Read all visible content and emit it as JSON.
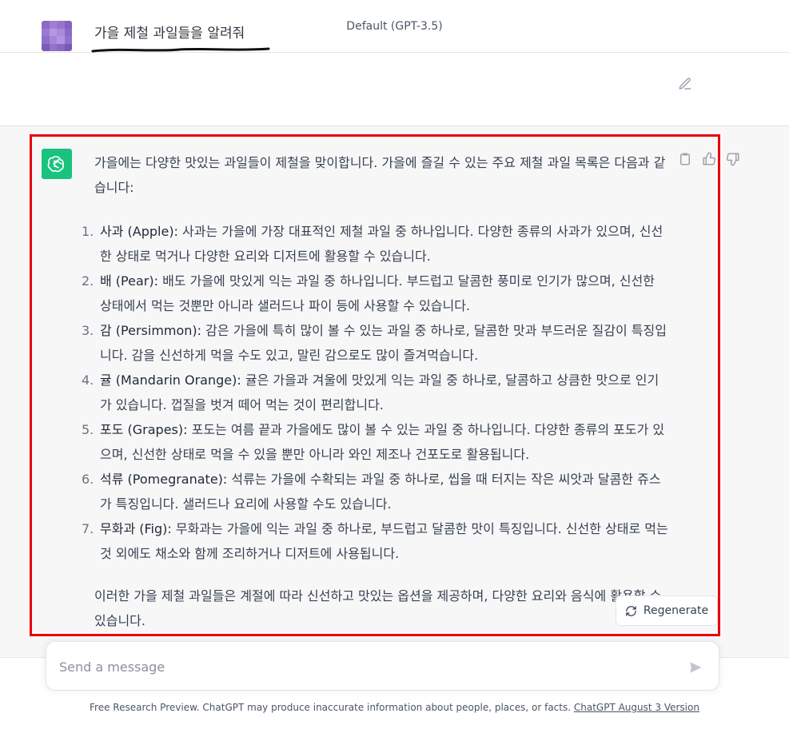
{
  "header": {
    "model_label": "Default (GPT-3.5)"
  },
  "user_message": {
    "text": "가을 제철 과일들을 알려줘"
  },
  "assistant_message": {
    "intro": "가을에는 다양한 맛있는 과일들이 제철을 맞이합니다. 가을에 즐길 수 있는 주요 제철 과일 목록은 다음과 같습니다:",
    "items": [
      {
        "num": "1.",
        "name": "사과 (Apple):",
        "desc": " 사과는 가을에 가장 대표적인 제철 과일 중 하나입니다. 다양한 종류의 사과가 있으며, 신선한 상태로 먹거나 다양한 요리와 디저트에 활용할 수 있습니다."
      },
      {
        "num": "2.",
        "name": "배 (Pear):",
        "desc": " 배도 가을에 맛있게 익는 과일 중 하나입니다. 부드럽고 달콤한 풍미로 인기가 많으며, 신선한 상태에서 먹는 것뿐만 아니라 샐러드나 파이 등에 사용할 수 있습니다."
      },
      {
        "num": "3.",
        "name": "감 (Persimmon):",
        "desc": " 감은 가을에 특히 많이 볼 수 있는 과일 중 하나로, 달콤한 맛과 부드러운 질감이 특징입니다. 감을 신선하게 먹을 수도 있고, 말린 감으로도 많이 즐겨먹습니다."
      },
      {
        "num": "4.",
        "name": "귤 (Mandarin Orange):",
        "desc": " 귤은 가을과 겨울에 맛있게 익는 과일 중 하나로, 달콤하고 상큼한 맛으로 인기가 있습니다. 껍질을 벗겨 떼어 먹는 것이 편리합니다."
      },
      {
        "num": "5.",
        "name": "포도 (Grapes):",
        "desc": " 포도는 여름 끝과 가을에도 많이 볼 수 있는 과일 중 하나입니다. 다양한 종류의 포도가 있으며, 신선한 상태로 먹을 수 있을 뿐만 아니라 와인 제조나 건포도로 활용됩니다."
      },
      {
        "num": "6.",
        "name": "석류 (Pomegranate):",
        "desc": " 석류는 가을에 수확되는 과일 중 하나로, 씹을 때 터지는 작은 씨앗과 달콤한 쥬스가 특징입니다. 샐러드나 요리에 사용할 수도 있습니다."
      },
      {
        "num": "7.",
        "name": "무화과 (Fig):",
        "desc": " 무화과는 가을에 익는 과일 중 하나로, 부드럽고 달콤한 맛이 특징입니다. 신선한 상태로 먹는 것 외에도 채소와 함께 조리하거나 디저트에 사용됩니다."
      }
    ],
    "outro": "이러한 가을 제철 과일들은 계절에 따라 신선하고 맛있는 옵션을 제공하며, 다양한 요리와 음식에 활용할 수 있습니다."
  },
  "regenerate": {
    "label": "Regenerate"
  },
  "composer": {
    "placeholder": "Send a message"
  },
  "footer": {
    "text": "Free Research Preview. ChatGPT may produce inaccurate information about people, places, or facts. ",
    "link": "ChatGPT August 3 Version"
  },
  "icons": {
    "edit": "pencil-edit-icon",
    "copy": "clipboard-icon",
    "like": "thumbs-up-icon",
    "dislike": "thumbs-down-icon",
    "regenerate": "refresh-icon",
    "send": "paper-plane-icon",
    "assistant_logo": "openai-logo-icon"
  },
  "colors": {
    "assistant_avatar_bg": "#19c37d",
    "assistant_row_bg": "#f7f7f8",
    "highlight_border": "#e8000b"
  }
}
